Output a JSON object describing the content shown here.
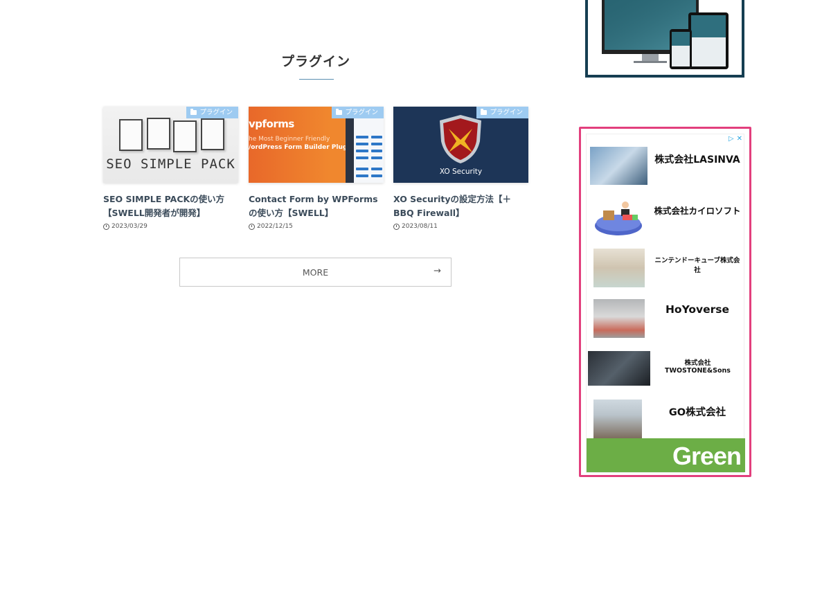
{
  "section": {
    "title": "プラグイン"
  },
  "cards": [
    {
      "category": "プラグイン",
      "thumb_text": "SEO SIMPLE PACK",
      "title": "SEO SIMPLE PACKの使い方【SWELL開発者が開発】",
      "date": "2023/03/29"
    },
    {
      "category": "プラグイン",
      "thumb_brand": "vpforms",
      "thumb_line1": "he Most Beginner Friendly",
      "thumb_line2": "/ordPress Form Builder Plugin",
      "title": "Contact Form by WPFormsの使い方【SWELL】",
      "date": "2022/12/15"
    },
    {
      "category": "プラグイン",
      "thumb_text": "XO Security",
      "title": " XO Securityの設定方法【＋BBQ Firewall】",
      "date": "2023/08/11"
    }
  ],
  "more_button": {
    "label": "MORE",
    "arrow": "→"
  },
  "ad": {
    "items": [
      {
        "name": "株式会社LASINVA"
      },
      {
        "name": "株式会社カイロソフト"
      },
      {
        "name": "ニンテンドーキューブ株式会社"
      },
      {
        "name": "HoYoverse"
      },
      {
        "name": "株式会社TWOSTONE&Sons"
      },
      {
        "name": "GO株式会社"
      }
    ],
    "banner_text": "Green"
  },
  "colors": {
    "accent": "#e23f7d",
    "category_badge": "#9ecbf1",
    "green": "#6cae46"
  }
}
